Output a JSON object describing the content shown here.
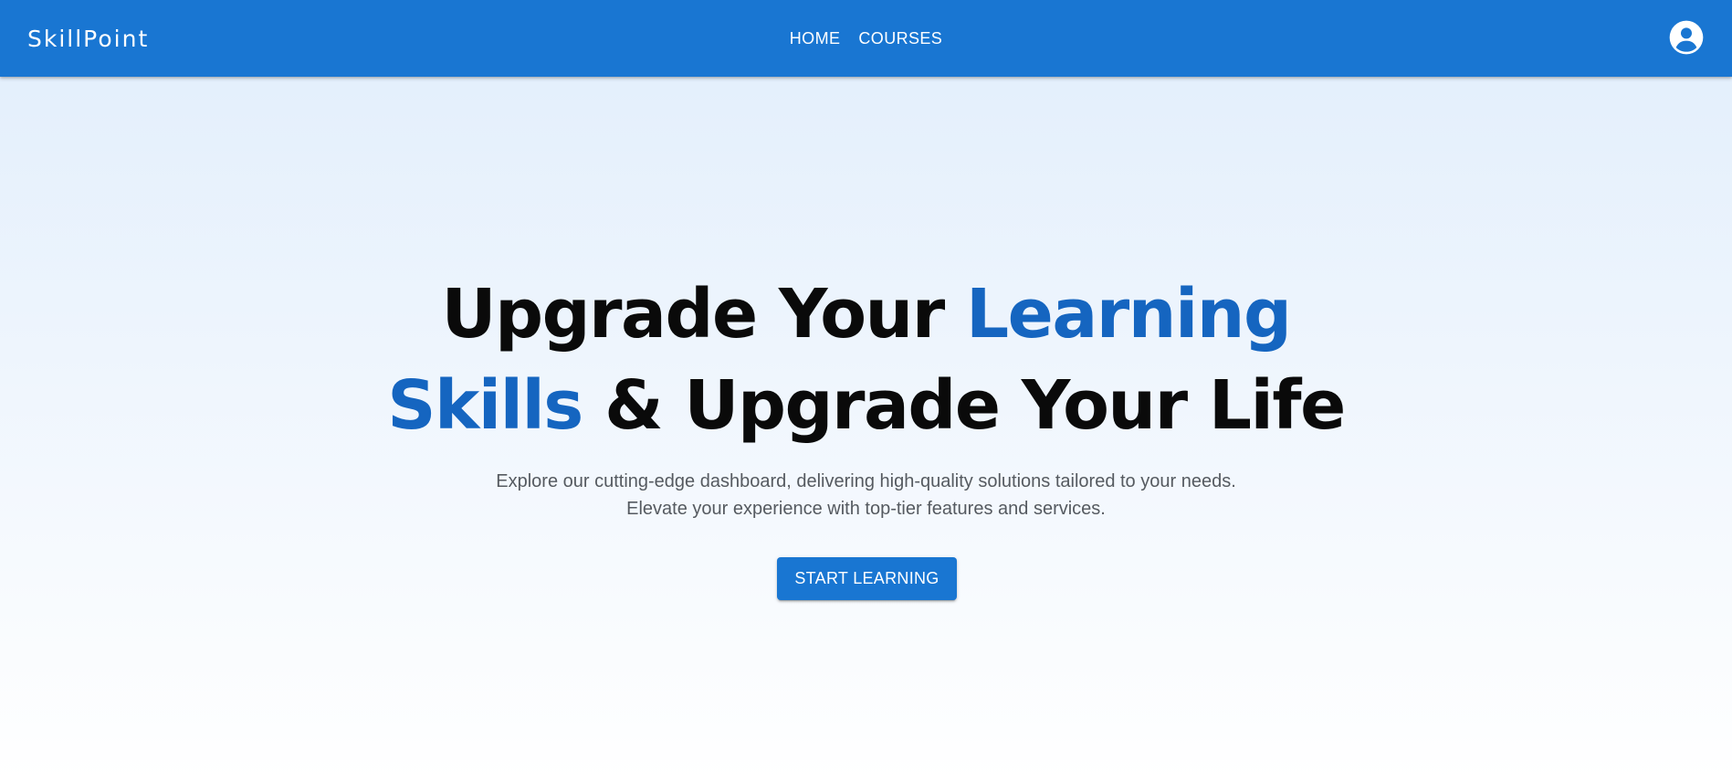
{
  "header": {
    "brand": "SkillPoint",
    "nav": [
      {
        "label": "HOME"
      },
      {
        "label": "COURSES"
      }
    ],
    "account_icon": "account-circle-icon"
  },
  "hero": {
    "headline": {
      "part1": "Upgrade Your ",
      "accent1": "Learning",
      "accent2": "Skills",
      "part2": " & Upgrade Your Life"
    },
    "subtitle_line1": "Explore our cutting-edge dashboard, delivering high-quality solutions tailored to your needs.",
    "subtitle_line2": "Elevate your experience with top-tier features and services.",
    "cta_label": "START LEARNING"
  },
  "colors": {
    "appbar": "#1976d2",
    "accent_text": "#1565c0",
    "headline_text": "#0a0a0a",
    "subtitle_text": "#555a60",
    "background_top": "#e1eefc",
    "background_bottom": "#ffffff"
  }
}
